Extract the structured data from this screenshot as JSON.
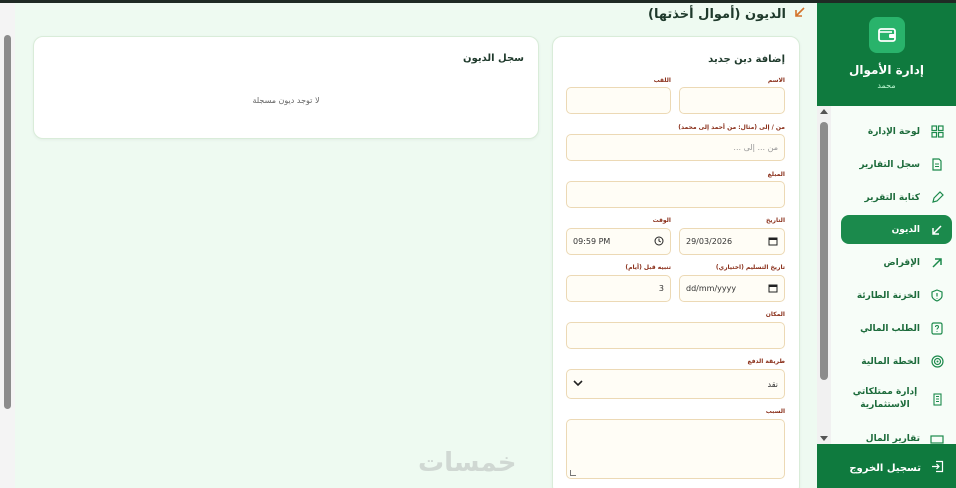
{
  "sidebar": {
    "title": "إدارة الأموال",
    "user": "محمد",
    "items": [
      {
        "label": "لوحة الإدارة",
        "icon": "dashboard-icon"
      },
      {
        "label": "سجل التقارير",
        "icon": "document-icon"
      },
      {
        "label": "كتابة التقرير",
        "icon": "pen-icon"
      },
      {
        "label": "الديون",
        "icon": "arrow-down-left-icon"
      },
      {
        "label": "الإقراض",
        "icon": "arrow-up-right-icon"
      },
      {
        "label": "الخزنة الطارئة",
        "icon": "shield-icon"
      },
      {
        "label": "الطلب المالي",
        "icon": "question-icon"
      },
      {
        "label": "الخطة المالية",
        "icon": "target-icon"
      },
      {
        "label": "إدارة ممتلكاتي الاستثمارية",
        "icon": "building-icon"
      },
      {
        "label": "تقارير المال",
        "icon": "cash-icon"
      }
    ],
    "active_index": 3,
    "logout": "تسجيل الخروج"
  },
  "header": {
    "title": "الديون (أموال أخذتها)"
  },
  "log_card": {
    "title": "سجل الديون",
    "empty": "لا توجد ديون مسجلة"
  },
  "form": {
    "title": "إضافة دين جديد",
    "name_label": "الاسم",
    "surname_label": "اللقب",
    "from_to_label": "من / إلى (مثال: من أحمد إلى محمد)",
    "from_to_placeholder": "من ... إلى ...",
    "amount_label": "المبلغ",
    "date_label": "التاريخ",
    "date_value": "29/03/2026",
    "time_label": "الوقت",
    "time_value": "09:59 PM",
    "delivery_label": "تاريخ التسليم (اختياري)",
    "delivery_placeholder": "dd/mm/yyyy",
    "remind_label": "تنبيه قبل (أيام)",
    "remind_value": "3",
    "place_label": "المكان",
    "payment_label": "طريقة الدفع",
    "payment_value": "نقد",
    "reason_label": "السبب"
  },
  "watermark": "خمسات"
}
